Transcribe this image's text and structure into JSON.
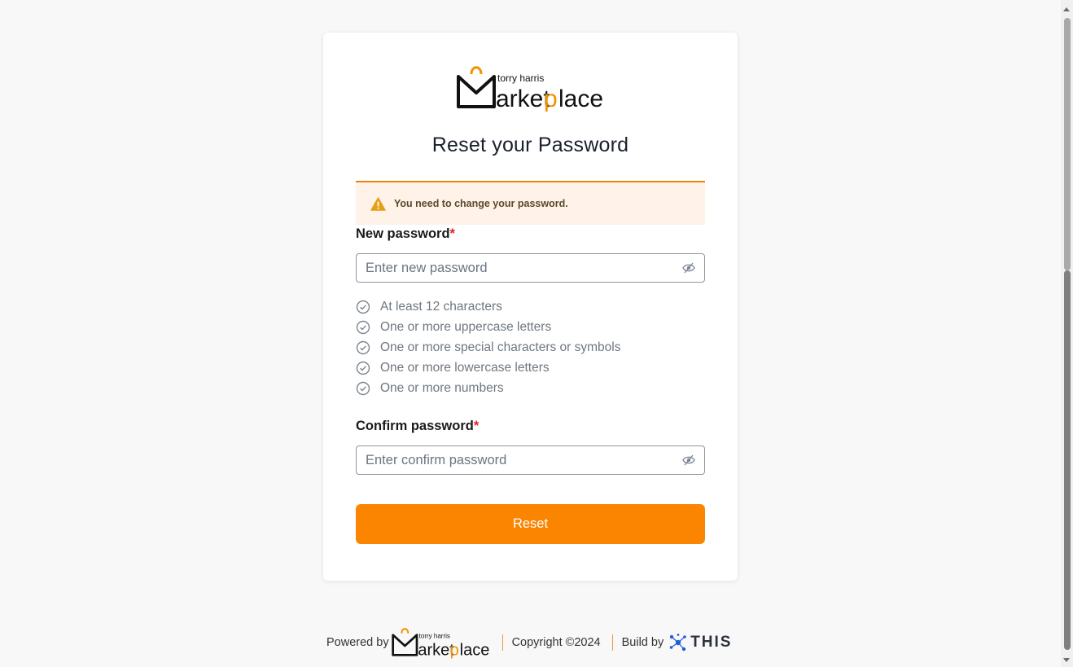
{
  "logo": {
    "top_text": "torry harris",
    "main_text": "Marketplace"
  },
  "page": {
    "title": "Reset your Password"
  },
  "alert": {
    "message": "You need to change your password.",
    "icon": "warning-icon"
  },
  "new_password": {
    "label": "New password",
    "required_mark": "*",
    "placeholder": "Enter new password"
  },
  "rules": [
    "At least 12 characters",
    "One or more uppercase letters",
    "One or more special characters or symbols",
    "One or more lowercase letters",
    "One or more numbers"
  ],
  "confirm_password": {
    "label": "Confirm password",
    "required_mark": "*",
    "placeholder": "Enter confirm password"
  },
  "reset_button": {
    "label": "Reset"
  },
  "footer": {
    "powered_by": "Powered by",
    "copyright": "Copyright ©2024",
    "build_by": "Build by",
    "build_brand": "THIS"
  },
  "colors": {
    "accent": "#fb8500",
    "alert_bg": "#fff2e8",
    "alert_border": "#e8850c",
    "required": "#e02424"
  }
}
